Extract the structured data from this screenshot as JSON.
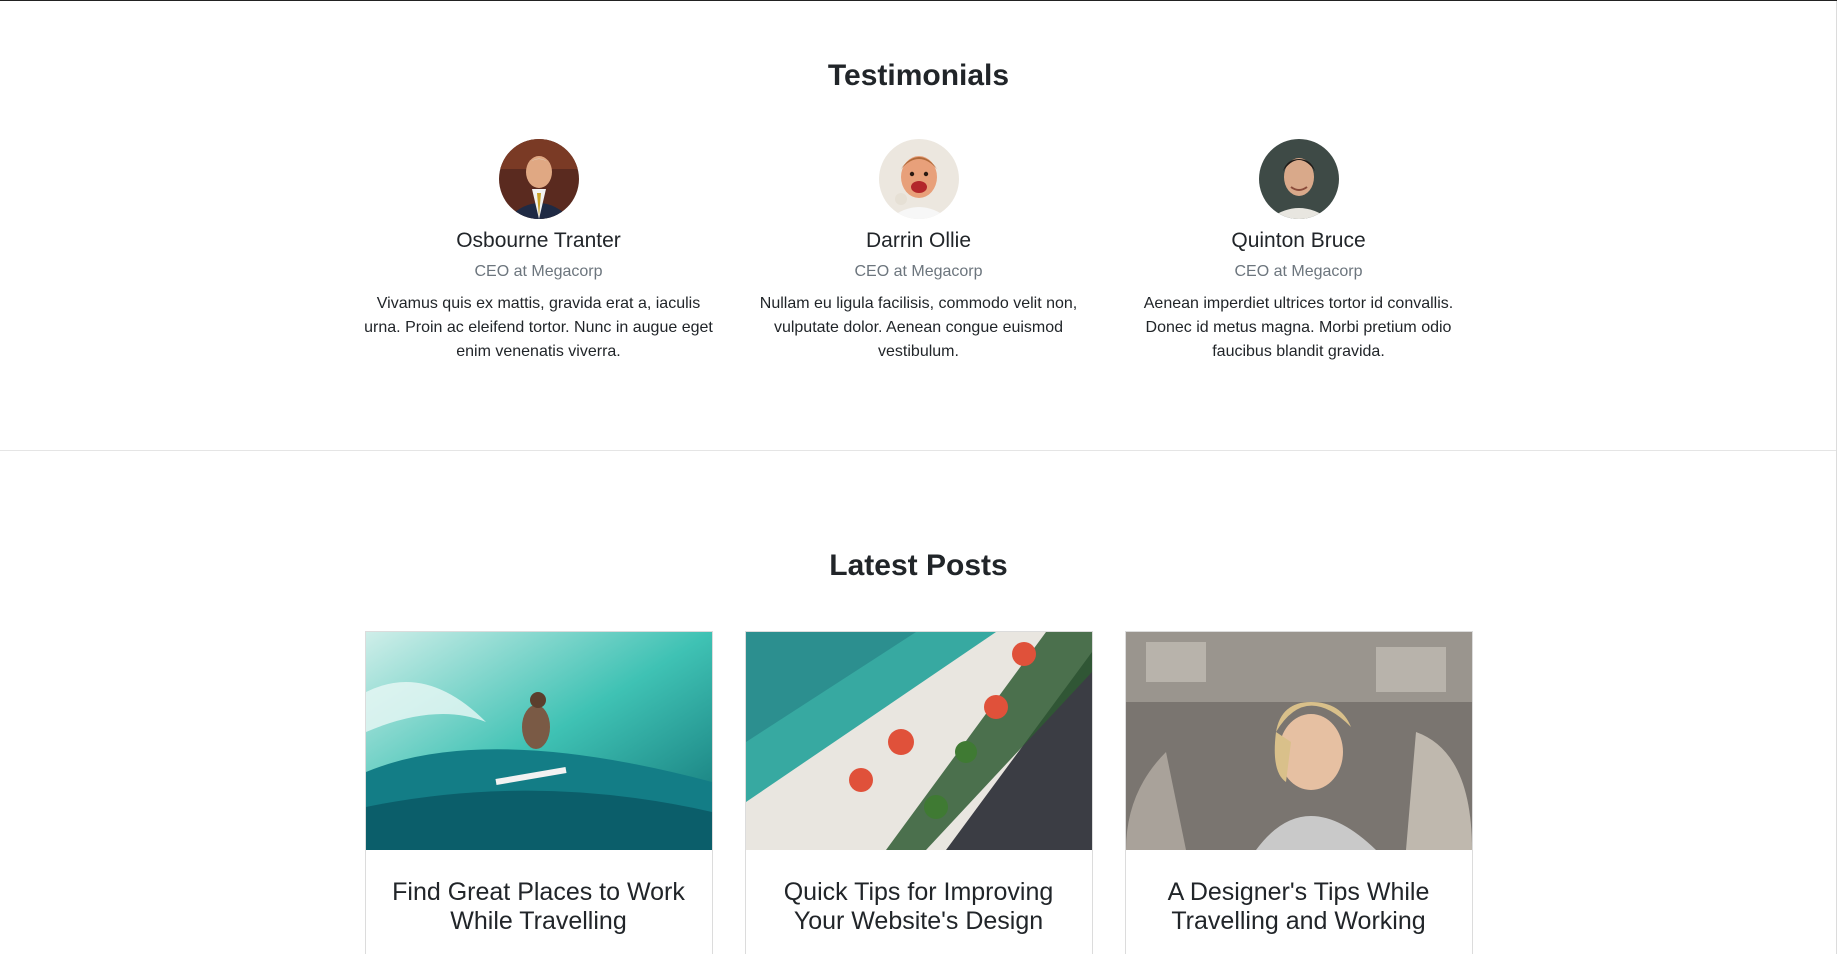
{
  "testimonials": {
    "title": "Testimonials",
    "items": [
      {
        "name": "Osbourne Tranter",
        "role": "CEO at Megacorp",
        "quote": "Vivamus quis ex mattis, gravida erat a, iaculis urna. Proin ac eleifend tortor. Nunc in augue eget enim venenatis viverra."
      },
      {
        "name": "Darrin Ollie",
        "role": "CEO at Megacorp",
        "quote": "Nullam eu ligula facilisis, commodo velit non, vulputate dolor. Aenean congue euismod vestibulum."
      },
      {
        "name": "Quinton Bruce",
        "role": "CEO at Megacorp",
        "quote": "Aenean imperdiet ultrices tortor id convallis. Donec id metus magna. Morbi pretium odio faucibus blandit gravida."
      }
    ]
  },
  "posts": {
    "title": "Latest Posts",
    "items": [
      {
        "title": "Find Great Places to Work While Travelling"
      },
      {
        "title": "Quick Tips for Improving Your Website's Design"
      },
      {
        "title": "A Designer's Tips While Travelling and Working"
      }
    ]
  }
}
